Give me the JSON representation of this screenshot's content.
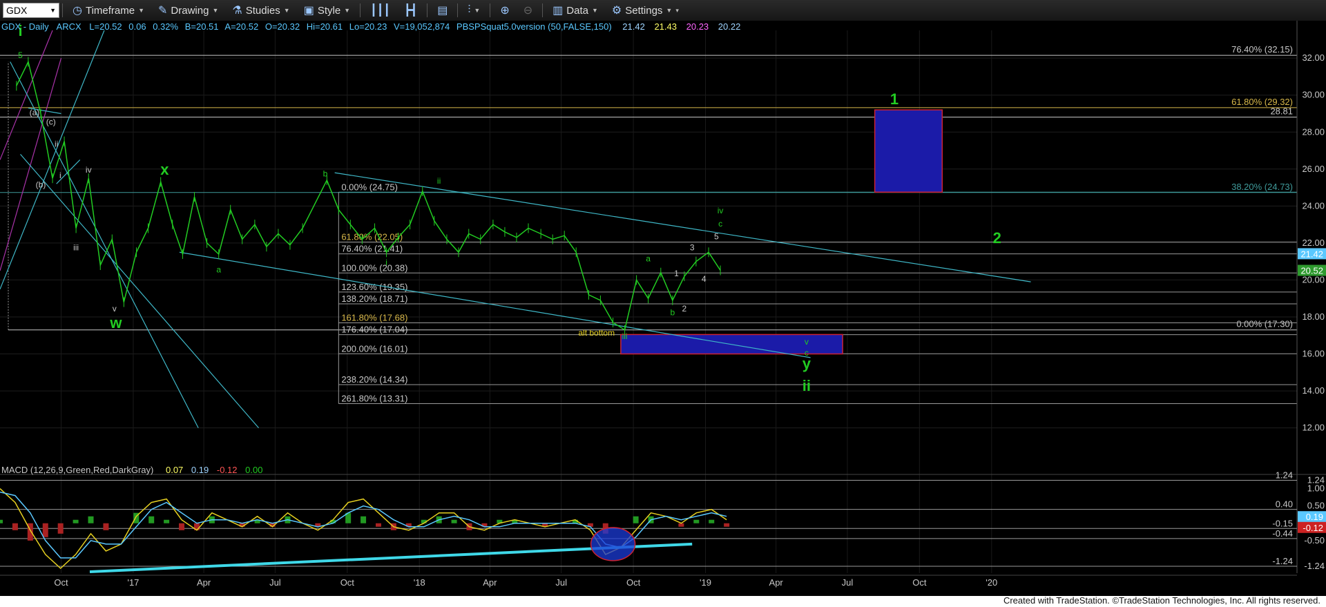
{
  "toolbar": {
    "symbol": "GDX",
    "items": [
      "Timeframe",
      "Drawing",
      "Studies",
      "Style",
      "Data",
      "Settings"
    ]
  },
  "header": {
    "title": "GDX - Daily",
    "exchange": "ARCX",
    "last": "L=20.52",
    "change": "0.06",
    "pct": "0.32%",
    "bid": "B=20.51",
    "ask": "A=20.52",
    "open": "O=20.32",
    "high": "Hi=20.61",
    "low": "Lo=20.23",
    "volume": "V=19,052,874",
    "study": "PBSPSquat5.0version (50,FALSE,150)",
    "study_values": [
      {
        "text": "21.42",
        "color": "#9fd4ff"
      },
      {
        "text": "21.43",
        "color": "#ffff66"
      },
      {
        "text": "20.23",
        "color": "#ff66ff"
      },
      {
        "text": "20.22",
        "color": "#9fd4ff"
      }
    ]
  },
  "macd_header": {
    "title": "MACD (12,26,9,Green,Red,DarkGray)",
    "values": [
      {
        "text": "0.07",
        "color": "#ffff66"
      },
      {
        "text": "0.19",
        "color": "#9fd4ff"
      },
      {
        "text": "-0.12",
        "color": "#ff5555"
      },
      {
        "text": "0.00",
        "color": "#22cc22"
      }
    ]
  },
  "footer": "Created with TradeStation. ©TradeStation Technologies, Inc. All rights reserved.",
  "chart_data": [
    {
      "type": "line",
      "title": "GDX - Daily",
      "y_range": [
        11.5,
        33.5
      ],
      "y_ticks": [
        12.0,
        14.0,
        16.0,
        18.0,
        20.0,
        22.0,
        24.0,
        26.0,
        28.0,
        30.0,
        32.0
      ],
      "x_tick_labels": [
        "Oct",
        "'17",
        "Apr",
        "Jul",
        "Oct",
        "'18",
        "Apr",
        "Jul",
        "Oct",
        "'19",
        "Apr",
        "Jul",
        "Oct",
        "'20"
      ],
      "price_series": {
        "name": "GDX",
        "color": "#22cc22",
        "x": [
          "2016-08",
          "2016-08",
          "2016-09",
          "2016-09",
          "2016-10",
          "2016-10",
          "2016-11",
          "2016-11",
          "2016-12",
          "2016-12",
          "2017-01",
          "2017-01",
          "2017-02",
          "2017-02",
          "2017-03",
          "2017-03",
          "2017-04",
          "2017-04",
          "2017-05",
          "2017-05",
          "2017-06",
          "2017-06",
          "2017-07",
          "2017-07",
          "2017-08",
          "2017-09",
          "2017-09",
          "2017-10",
          "2017-10",
          "2017-11",
          "2017-11",
          "2017-12",
          "2017-12",
          "2018-01",
          "2018-01",
          "2018-02",
          "2018-02",
          "2018-03",
          "2018-03",
          "2018-04",
          "2018-04",
          "2018-05",
          "2018-05",
          "2018-06",
          "2018-06",
          "2018-07",
          "2018-07",
          "2018-08",
          "2018-08",
          "2018-09",
          "2018-09",
          "2018-10",
          "2018-10",
          "2018-11",
          "2018-11",
          "2018-12",
          "2018-12",
          "2019-01",
          "2019-01"
        ],
        "values": [
          30.5,
          31.8,
          29.0,
          25.5,
          27.5,
          22.8,
          25.5,
          20.8,
          22.2,
          18.8,
          21.5,
          22.8,
          25.3,
          23.0,
          21.4,
          24.5,
          22.0,
          21.4,
          23.8,
          22.2,
          23.0,
          21.8,
          22.5,
          21.9,
          22.8,
          25.4,
          23.8,
          23.0,
          22.2,
          22.8,
          21.5,
          22.3,
          23.0,
          24.8,
          23.2,
          22.2,
          21.5,
          22.5,
          22.2,
          23.0,
          22.6,
          22.3,
          22.8,
          22.5,
          22.2,
          22.4,
          21.5,
          19.2,
          18.9,
          17.7,
          17.3,
          20.0,
          19.0,
          20.4,
          18.9,
          20.2,
          21.0,
          21.5,
          20.52
        ]
      },
      "horizontal_levels": [
        {
          "label": "76.40% (32.15)",
          "y": 32.15,
          "color": "#c9c9c9"
        },
        {
          "label": "61.80% (29.32)",
          "y": 29.32,
          "color": "#d8b84a"
        },
        {
          "label": "28.81",
          "y": 28.81,
          "color": "#c9c9c9"
        },
        {
          "label": "38.20% (24.73)",
          "y": 24.73,
          "color": "#3f9a9a"
        },
        {
          "label": "0.00% (17.30)",
          "y": 17.3,
          "color": "#c9c9c9"
        }
      ],
      "fib_levels": [
        {
          "label": "0.00% (24.75)",
          "y": 24.75
        },
        {
          "label": "61.80% (22.05)",
          "y": 22.05
        },
        {
          "label": "76.40% (21.41)",
          "y": 21.41
        },
        {
          "label": "100.00% (20.38)",
          "y": 20.38
        },
        {
          "label": "123.60% (19.35)",
          "y": 19.35
        },
        {
          "label": "138.20% (18.71)",
          "y": 18.71
        },
        {
          "label": "161.80% (17.68)",
          "y": 17.68
        },
        {
          "label": "176.40% (17.04)",
          "y": 17.04
        },
        {
          "label": "200.00% (16.01)",
          "y": 16.01
        },
        {
          "label": "238.20% (14.34)",
          "y": 14.34
        },
        {
          "label": "261.80% (13.31)",
          "y": 13.31
        }
      ],
      "target_boxes": [
        {
          "label": "1",
          "y_top": 29.2,
          "y_bottom": 24.75,
          "color": "#1b1ba8"
        },
        {
          "label": "",
          "y_top": 17.05,
          "y_bottom": 16.0,
          "color": "#1b1ba8"
        }
      ],
      "price_markers": [
        {
          "text": "21.42",
          "y": 21.42,
          "color": "#5ac8ff"
        },
        {
          "text": "20.52",
          "y": 20.52,
          "color": "#2e9a2e"
        }
      ],
      "wave_labels": [
        {
          "text": "i",
          "color": "#22cc22",
          "big": true
        },
        {
          "text": "5",
          "color": "#22cc22"
        },
        {
          "text": "(a)",
          "color": "#c9c9c9"
        },
        {
          "text": "(c)",
          "color": "#c9c9c9"
        },
        {
          "text": "(b)",
          "color": "#c9c9c9"
        },
        {
          "text": "ii",
          "color": "#c9c9c9"
        },
        {
          "text": "i",
          "color": "#c9c9c9"
        },
        {
          "text": "iii",
          "color": "#c9c9c9"
        },
        {
          "text": "iv",
          "color": "#c9c9c9"
        },
        {
          "text": "v",
          "color": "#c9c9c9"
        },
        {
          "text": "w",
          "color": "#22cc22",
          "big": true
        },
        {
          "text": "x",
          "color": "#22cc22",
          "big": true
        },
        {
          "text": "a",
          "color": "#22cc22"
        },
        {
          "text": "b",
          "color": "#22cc22"
        },
        {
          "text": "ii",
          "color": "#22cc22"
        },
        {
          "text": "i",
          "color": "#22cc22"
        },
        {
          "text": "alt bottom",
          "color": "#e6d020"
        },
        {
          "text": "iii",
          "color": "#22cc22"
        },
        {
          "text": "a",
          "color": "#22cc22"
        },
        {
          "text": "b",
          "color": "#22cc22"
        },
        {
          "text": "1",
          "color": "#c9c9c9"
        },
        {
          "text": "2",
          "color": "#c9c9c9"
        },
        {
          "text": "3",
          "color": "#c9c9c9"
        },
        {
          "text": "4",
          "color": "#c9c9c9"
        },
        {
          "text": "5",
          "color": "#c9c9c9"
        },
        {
          "text": "iv",
          "color": "#22cc22"
        },
        {
          "text": "c",
          "color": "#22cc22"
        },
        {
          "text": "v",
          "color": "#22cc22"
        },
        {
          "text": "c",
          "color": "#22cc22"
        },
        {
          "text": "y",
          "color": "#22cc22",
          "big": true
        },
        {
          "text": "ii",
          "color": "#22cc22",
          "big": true
        },
        {
          "text": "1",
          "color": "#22cc22",
          "big": true
        },
        {
          "text": "2",
          "color": "#22cc22",
          "big": true
        }
      ]
    },
    {
      "type": "line",
      "title": "MACD (12,26,9,Green,Red,DarkGray)",
      "y_range": [
        -1.4,
        1.35
      ],
      "y_ticks": [
        1.24,
        1.0,
        0.5,
        -0.5,
        -1.24
      ],
      "levels": [
        {
          "label": "1.24",
          "y": 1.24
        },
        {
          "label": "0.40",
          "y": 0.4
        },
        {
          "label": "-0.15",
          "y": -0.15
        },
        {
          "label": "-0.44",
          "y": -0.44
        },
        {
          "label": "-1.24",
          "y": -1.24
        }
      ],
      "markers": [
        {
          "text": "0.19",
          "y": 0.19,
          "color": "#5ac8ff"
        },
        {
          "text": "-0.12",
          "y": -0.12,
          "color": "#cc2222"
        }
      ],
      "series": [
        {
          "name": "MACD",
          "color": "#e6d020",
          "values": [
            1.0,
            0.6,
            -0.2,
            -0.9,
            -1.3,
            -0.9,
            -0.3,
            -0.8,
            -0.6,
            0.2,
            0.6,
            0.7,
            0.1,
            -0.2,
            0.3,
            0.1,
            -0.1,
            0.2,
            -0.1,
            0.3,
            0.0,
            -0.2,
            0.1,
            0.6,
            0.7,
            0.3,
            -0.1,
            -0.2,
            0.0,
            0.3,
            0.3,
            -0.1,
            -0.2,
            0.0,
            0.1,
            0.0,
            -0.1,
            0.0,
            0.1,
            -0.2,
            -0.9,
            -0.7,
            -0.2,
            0.3,
            0.2,
            0.0,
            0.3,
            0.4,
            0.1
          ]
        },
        {
          "name": "Signal",
          "color": "#5ac8ff",
          "values": [
            0.9,
            0.8,
            0.3,
            -0.5,
            -1.0,
            -1.0,
            -0.5,
            -0.6,
            -0.6,
            -0.1,
            0.4,
            0.6,
            0.3,
            0.0,
            0.1,
            0.1,
            0.0,
            0.1,
            0.0,
            0.1,
            0.0,
            -0.1,
            0.0,
            0.3,
            0.5,
            0.4,
            0.1,
            -0.1,
            -0.1,
            0.1,
            0.2,
            0.1,
            -0.1,
            -0.1,
            0.0,
            0.0,
            0.0,
            0.0,
            0.0,
            -0.1,
            -0.6,
            -0.7,
            -0.4,
            0.1,
            0.2,
            0.1,
            0.2,
            0.3,
            0.2
          ]
        }
      ]
    }
  ]
}
